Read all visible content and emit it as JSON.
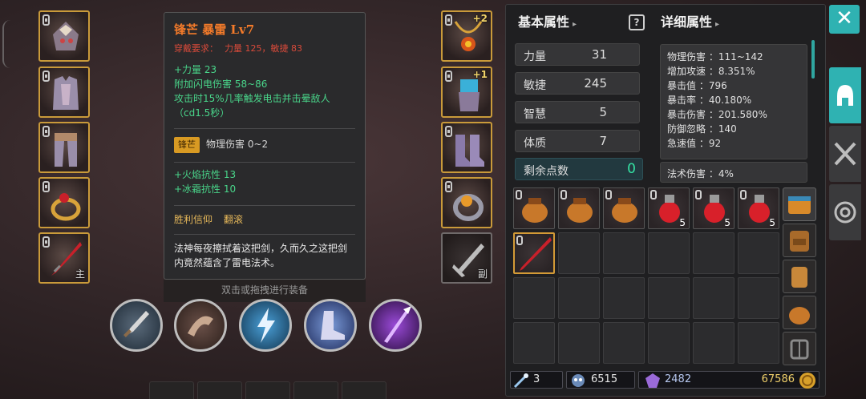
{
  "equipment_left": [
    {
      "name": "helmet-slot",
      "tag": ""
    },
    {
      "name": "chest-armor-slot",
      "tag": ""
    },
    {
      "name": "leg-armor-slot",
      "tag": ""
    },
    {
      "name": "ring-slot",
      "tag": ""
    },
    {
      "name": "main-weapon-slot",
      "tag": "主"
    }
  ],
  "equipment_right": [
    {
      "name": "necklace-slot",
      "plus": "+2",
      "tag": ""
    },
    {
      "name": "gloves-slot",
      "plus": "+1",
      "tag": ""
    },
    {
      "name": "boots-slot",
      "plus": "",
      "tag": ""
    },
    {
      "name": "ring2-slot",
      "plus": "",
      "tag": ""
    },
    {
      "name": "offhand-slot",
      "plus": "",
      "tag": "副"
    }
  ],
  "tooltip": {
    "title": "锋芒 暴雷 Lv7",
    "req_label": "穿戴要求：",
    "req_values": "力量 125，敏捷 83",
    "attr1": "+力量 23",
    "attr2": "附加闪电伤害 58~86",
    "attr3": "攻击时15%几率触发电击并击晕敌人（cd1.5秒）",
    "badge": "锋芒",
    "phys": "物理伤害 0~2",
    "res1": "+火焰抗性 13",
    "res2": "+冰霜抗性 10",
    "faith_label": "胜利信仰",
    "faith_value": "翻滚",
    "desc": "法神每夜擦拭着这把剑，久而久之这把剑内竟然蕴含了雷电法术。"
  },
  "equip_hint": "双击或拖拽进行装备",
  "basic": {
    "title": "基本属性",
    "stats": [
      {
        "label": "力量",
        "value": "31"
      },
      {
        "label": "敏捷",
        "value": "245"
      },
      {
        "label": "智慧",
        "value": "5"
      },
      {
        "label": "体质",
        "value": "7"
      }
    ],
    "points_label": "剩余点数",
    "points_value": "0"
  },
  "detail": {
    "title": "详细属性",
    "lines": [
      "物理伤害 ：111~142",
      "增加攻速 ：8.351%",
      "暴击值 ：796",
      "暴击率 ：40.180%",
      "暴击伤害 ：201.580%",
      "防御忽略 ：140",
      "急速值 ：92"
    ],
    "extra": "法术伤害 ：4%"
  },
  "inventory": {
    "counts": [
      "",
      "",
      "",
      "5",
      "5",
      "5"
    ]
  },
  "status": {
    "keys": "3",
    "shards": "6515",
    "gems": "2482",
    "gold": "67586"
  },
  "colors": {
    "accent": "#2fb2b2",
    "gold_border": "#c99a3a",
    "green_attr": "#49d58a",
    "orange_title": "#f47b2a"
  }
}
